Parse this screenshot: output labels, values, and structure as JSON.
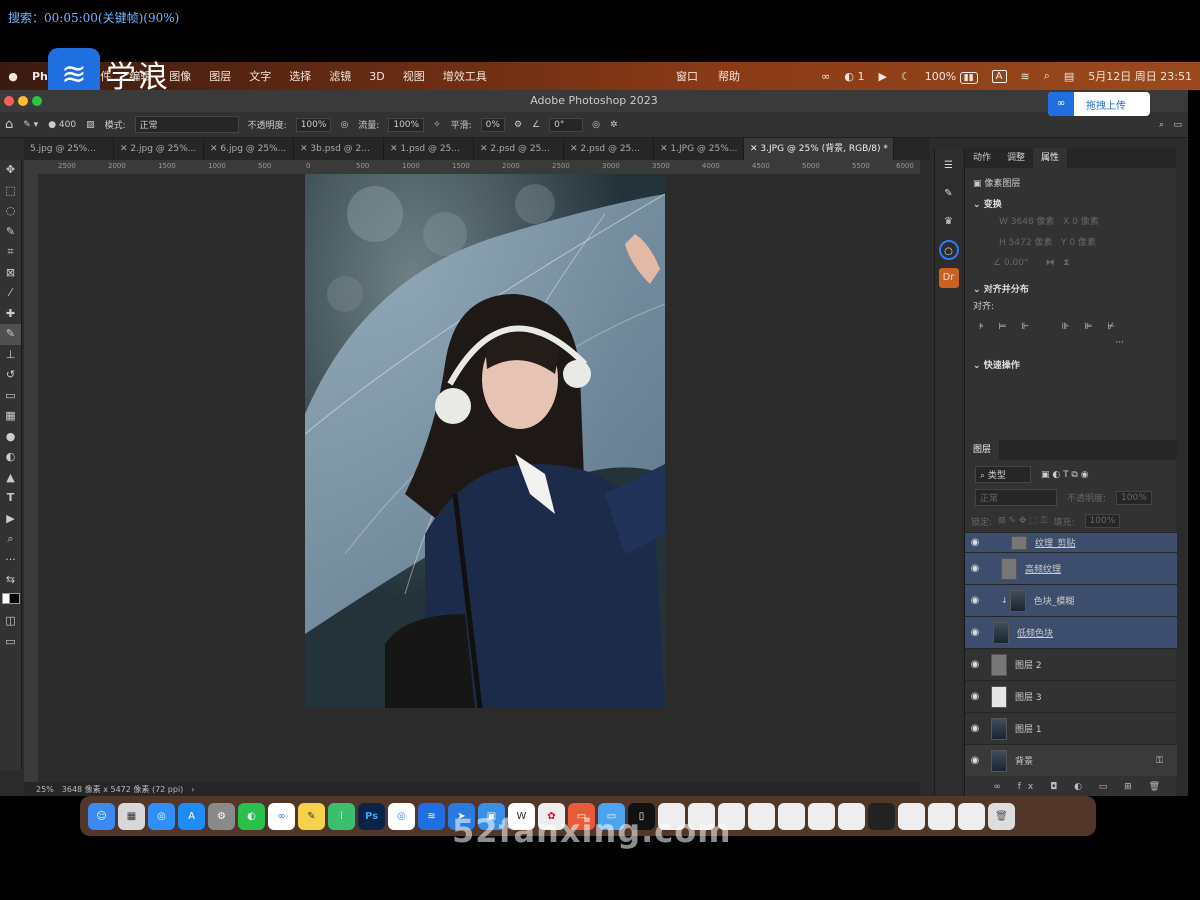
{
  "overlay": {
    "search_text": "搜索：00:05:00(关键帧)(90%)"
  },
  "menubar": {
    "apple": "",
    "app_name": "Photo",
    "items": [
      "文件",
      "编辑",
      "图像",
      "图层",
      "文字",
      "选择",
      "滤镜",
      "3D",
      "视图",
      "增效工具"
    ],
    "mid_items": [
      "窗口",
      "帮助"
    ],
    "wechat_count": "1",
    "battery": "100%",
    "input_method": "A",
    "datetime": "5月12日 周日 23:51"
  },
  "logo": {
    "text": "学浪"
  },
  "ps": {
    "title": "Adobe Photoshop 2023",
    "upload_label": "拖拽上传",
    "options": {
      "brush_size": "400",
      "mode_label": "模式:",
      "mode_value": "正常",
      "opacity_label": "不透明度:",
      "opacity_value": "100%",
      "flow_label": "流量:",
      "flow_value": "100%",
      "smooth_label": "平滑:",
      "smooth_value": "0%",
      "angle_value": "0°"
    },
    "tabs": [
      "5.jpg @ 25%...",
      "2.jpg @ 25%...",
      "6.jpg @ 25%...",
      "3b.psd @ 2...",
      "1.psd @ 25...",
      "2.psd @ 25...",
      "2.psd @ 25...",
      "1.JPG @ 25%...",
      "3.JPG @ 25% (背景, RGB/8) *"
    ],
    "ruler_ticks": [
      "2500",
      "2000",
      "1500",
      "1000",
      "500",
      "0",
      "500",
      "1000",
      "1500",
      "2000",
      "2500",
      "3000",
      "3500",
      "4000",
      "4500",
      "5000",
      "5500",
      "6000"
    ],
    "status": {
      "zoom": "25%",
      "info": "3648 像素 x 5472 像素 (72 ppi)"
    }
  },
  "panel": {
    "tabs": [
      "动作",
      "调整",
      "属性"
    ],
    "pixel_layer": "像素图层",
    "transform": "变换",
    "w_label": "W",
    "w_value": "3648 像素",
    "x_label": "X",
    "x_value": "0 像素",
    "h_label": "H",
    "h_value": "5472 像素",
    "y_label": "Y",
    "y_value": "0 像素",
    "angle_value": "0.00°",
    "align_title": "对齐并分布",
    "align_label": "对齐:",
    "quick_actions": "快速操作",
    "layers_tab": "图层",
    "kind_label": "类型",
    "blend_mode": "正常",
    "opacity_label": "不透明度:",
    "opacity_value": "100%",
    "lock_label": "锁定:",
    "fill_label": "填充:",
    "fill_value": "100%",
    "layers": [
      {
        "name": "纹理_剪贴",
        "selected": true
      },
      {
        "name": "高频纹理",
        "selected": true
      },
      {
        "name": "色块_模糊",
        "selected": true
      },
      {
        "name": "低频色块",
        "selected": true
      },
      {
        "name": "图层 2",
        "selected": false
      },
      {
        "name": "图层 3",
        "selected": false
      },
      {
        "name": "图层 1",
        "selected": false
      },
      {
        "name": "背景",
        "selected": false
      }
    ]
  },
  "watermark": {
    "text": "52fanxing.com"
  }
}
